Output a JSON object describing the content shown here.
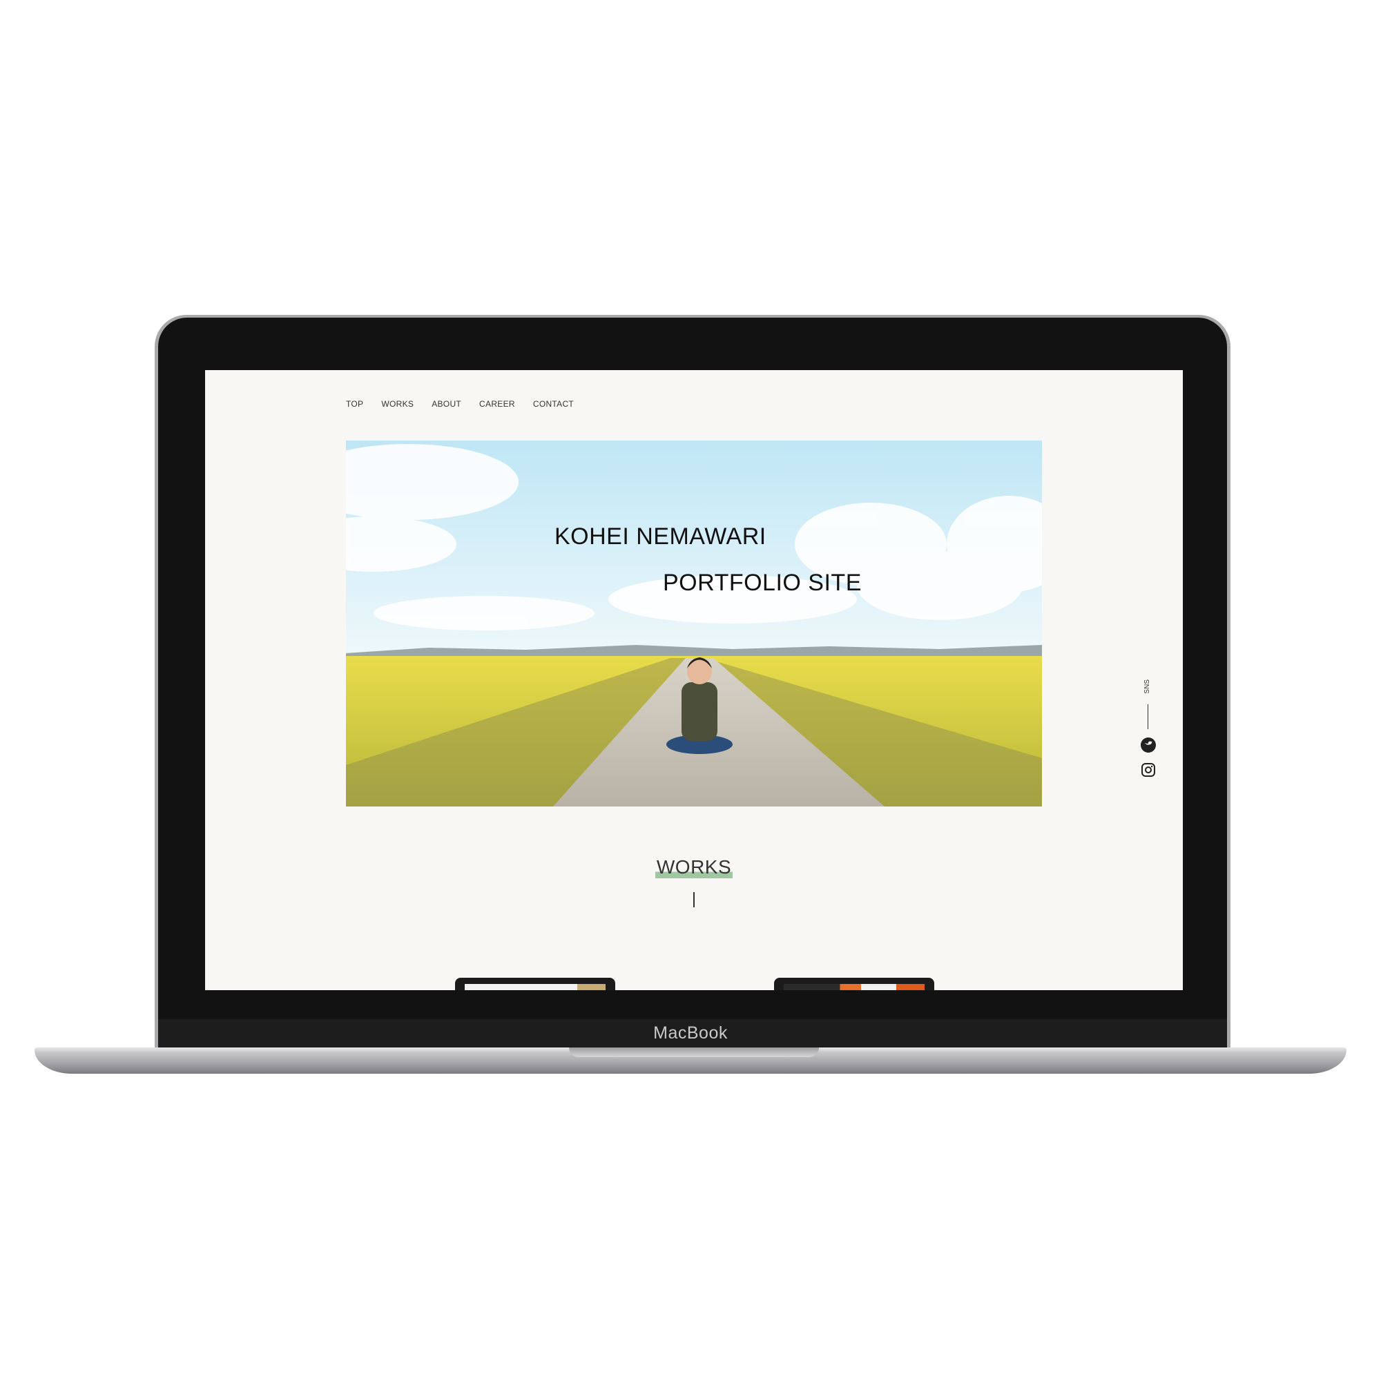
{
  "device": {
    "brand_label": "MacBook"
  },
  "nav": {
    "items": [
      "TOP",
      "WORKS",
      "ABOUT",
      "CAREER",
      "CONTACT"
    ]
  },
  "hero": {
    "title_line1": "KOHEI NEMAWARI",
    "title_line2": "PORTFOLIO SITE"
  },
  "sns": {
    "label": "SNS",
    "icons": [
      "twitter-icon",
      "instagram-icon"
    ]
  },
  "works": {
    "title": "WORKS"
  },
  "colors": {
    "page_bg": "#f8f7f3",
    "accent_underline": "#9fc7a2",
    "text": "#333333"
  }
}
